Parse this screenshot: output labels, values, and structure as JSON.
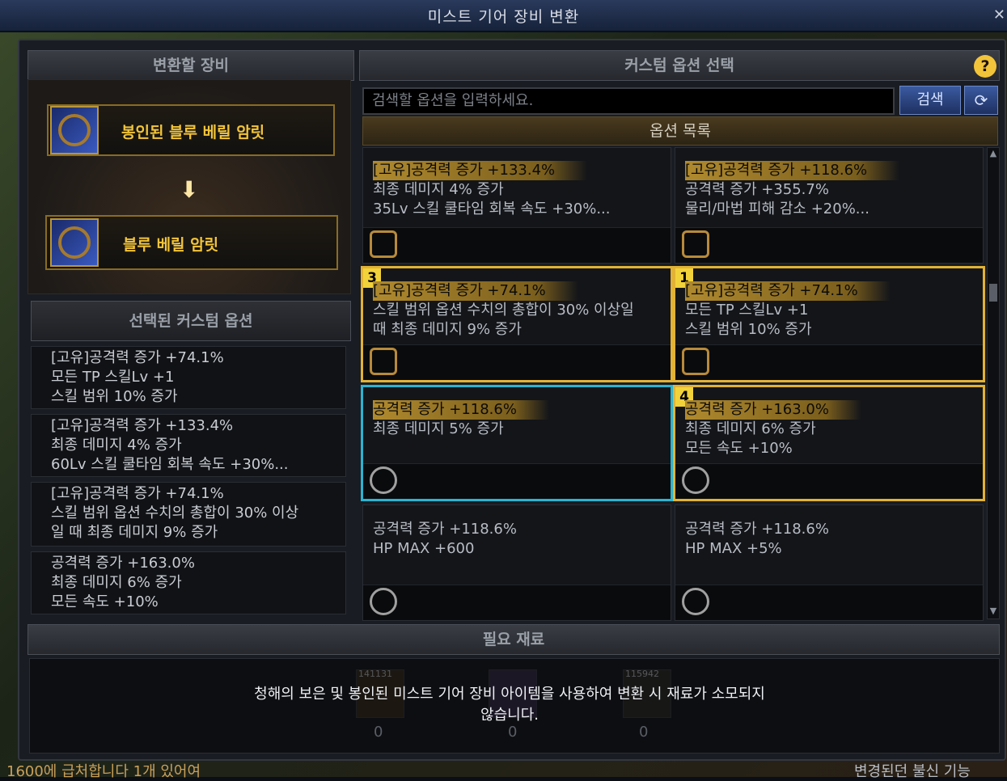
{
  "window": {
    "title": "미스트 기어 장비 변환",
    "close": "✕"
  },
  "left": {
    "header": "변환할 장비",
    "source_item": "봉인된 블루 베릴 암릿",
    "target_item": "블루 베릴 암릿",
    "selected_header": "선택된 커스텀 옵션",
    "selected_options": [
      [
        "[고유]공격력 증가 +74.1%",
        "모든 TP 스킬Lv +1",
        "스킬 범위 10% 증가"
      ],
      [
        "[고유]공격력 증가 +133.4%",
        "최종 데미지 4% 증가",
        "60Lv 스킬 쿨타임 회복 속도 +30%..."
      ],
      [
        "[고유]공격력 증가 +74.1%",
        "스킬 범위 옵션 수치의 총합이 30% 이상",
        "일 때 최종 데미지 9% 증가"
      ],
      [
        "공격력 증가 +163.0%",
        "최종 데미지 6% 증가",
        "모든 속도 +10%"
      ]
    ]
  },
  "right": {
    "header": "커스텀 옵션 선택",
    "help": "?",
    "search_placeholder": "검색할 옵션을 입력하세요.",
    "search_button": "검색",
    "refresh": "⟳",
    "list_header": "옵션 목록",
    "cards": [
      {
        "badge": "",
        "lines": [
          "[고유]공격력 증가 +133.4%",
          "최종 데미지 4% 증가",
          "35Lv 스킬 쿨타임 회복 속도 +30%..."
        ]
      },
      {
        "badge": "",
        "lines": [
          "[고유]공격력 증가 +118.6%",
          "공격력 증가 +355.7%",
          "물리/마법 피해 감소 +20%..."
        ]
      },
      {
        "badge": "3",
        "lines": [
          "[고유]공격력 증가 +74.1%",
          "스킬 범위 옵션 수치의 총합이 30% 이상일",
          "때 최종 데미지 9% 증가"
        ]
      },
      {
        "badge": "1",
        "lines": [
          "[고유]공격력 증가 +74.1%",
          "모든 TP 스킬Lv +1",
          "스킬 범위 10% 증가"
        ]
      },
      {
        "badge": "",
        "lines": [
          "공격력 증가 +118.6%",
          "최종 데미지 5% 증가"
        ]
      },
      {
        "badge": "4",
        "lines": [
          "공격력 증가 +163.0%",
          "최종 데미지 6% 증가",
          "모든 속도 +10%"
        ]
      },
      {
        "badge": "",
        "lines": [
          "공격력 증가 +118.6%",
          "HP MAX +600"
        ]
      },
      {
        "badge": "",
        "lines": [
          "공격력 증가 +118.6%",
          "HP MAX +5%"
        ]
      }
    ]
  },
  "materials": {
    "header": "필요 재료",
    "counts": [
      "141131",
      "115942"
    ],
    "zeros": [
      "0",
      "0",
      "0"
    ],
    "message_line1": "청해의 보은 및 봉인된 미스트 기어 장비 아이템을 사용하여 변환 시 재료가 소모되지",
    "message_line2": "않습니다."
  },
  "chat": {
    "left": "1600에 급처합니다 1개 있어여",
    "right": "변경된던 불신 기능"
  }
}
